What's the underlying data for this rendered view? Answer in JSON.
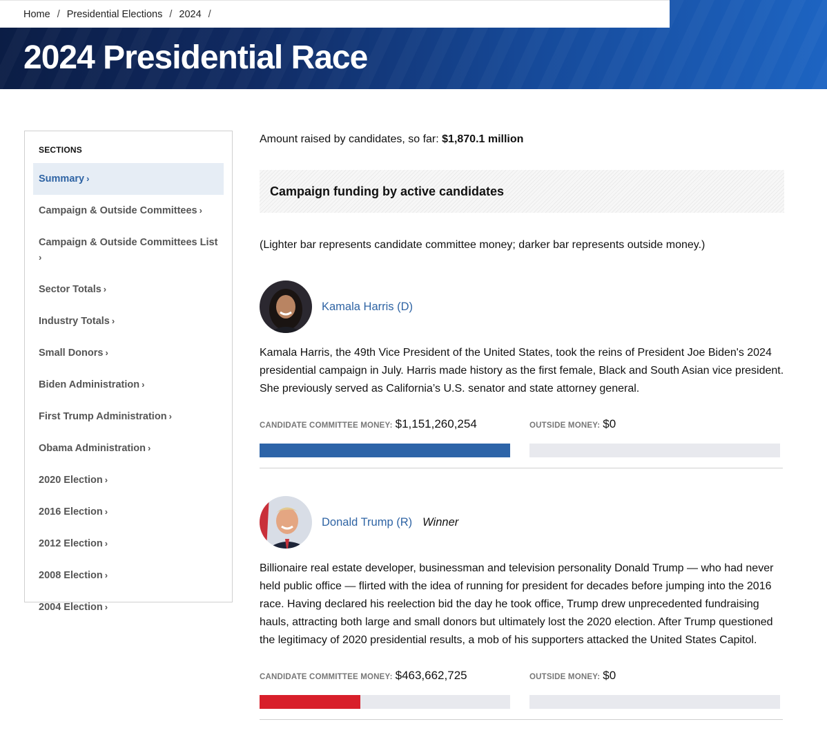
{
  "breadcrumb": [
    "Home",
    "Presidential Elections",
    "2024"
  ],
  "page_title": "2024 Presidential Race",
  "sidebar": {
    "title": "SECTIONS",
    "items": [
      {
        "label": "Summary",
        "active": true
      },
      {
        "label": "Campaign & Outside Committees"
      },
      {
        "label": "Campaign & Outside Committees List"
      },
      {
        "label": "Sector Totals"
      },
      {
        "label": "Industry Totals"
      },
      {
        "label": "Small Donors"
      },
      {
        "label": "Biden Administration"
      },
      {
        "label": "First Trump Administration"
      },
      {
        "label": "Obama Administration"
      },
      {
        "label": "2020 Election"
      },
      {
        "label": "2016 Election"
      },
      {
        "label": "2012 Election"
      },
      {
        "label": "2008 Election"
      },
      {
        "label": "2004 Election"
      }
    ]
  },
  "main": {
    "amount_prefix": "Amount raised by candidates, so far: ",
    "amount_value": "$1,870.1 million",
    "section_heading": "Campaign funding by active candidates",
    "note": "(Lighter bar represents candidate committee money; darker bar represents outside money.)",
    "candidates": [
      {
        "name": "Kamala Harris (D)",
        "winner": "",
        "bio": "Kamala Harris, the 49th Vice President of the United States, took the reins of President Joe Biden's 2024 presidential campaign in July. Harris made history as the first female, Black and South Asian vice president. She previously served as California’s U.S. senator and state attorney general.",
        "committee_label": "CANDIDATE COMMITTEE MONEY:",
        "committee_value": "$1,151,260,254",
        "committee_fill": 1.0,
        "outside_label": "OUTSIDE MONEY:",
        "outside_value": "$0",
        "outside_fill": 0,
        "bar_color": "#2d64a8"
      },
      {
        "name": "Donald Trump (R)",
        "winner": "Winner",
        "bio": "Billionaire real estate developer, businessman and television personality Donald Trump — who had never held public office — flirted with the idea of running for president for decades before jumping into the 2016 race. Having declared his reelection bid the day he took office, Trump drew unprecedented fundraising hauls, attracting both large and small donors but ultimately lost the 2020 election. After Trump questioned the legitimacy of 2020 presidential results, a mob of his supporters attacked the United States Capitol.",
        "committee_label": "CANDIDATE COMMITTEE MONEY:",
        "committee_value": "$463,662,725",
        "committee_fill": 0.4027,
        "outside_label": "OUTSIDE MONEY:",
        "outside_value": "$0",
        "outside_fill": 0,
        "bar_color": "#d81f2a"
      }
    ]
  }
}
